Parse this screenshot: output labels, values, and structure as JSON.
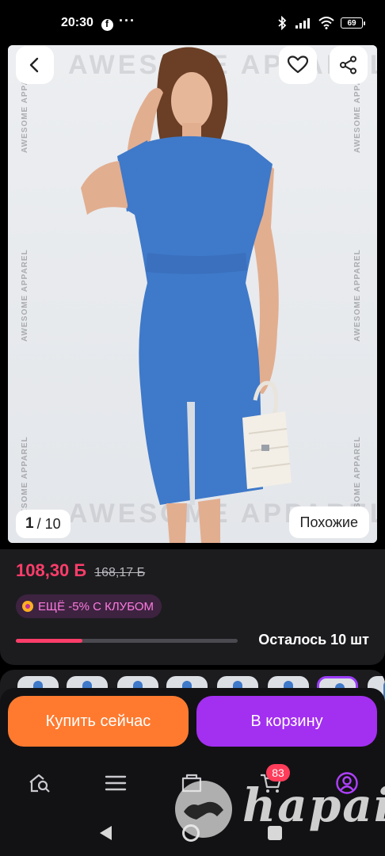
{
  "status_bar": {
    "time": "20:30",
    "extra": "···",
    "battery": "69"
  },
  "gallery": {
    "watermark_brand": "AWESOME APPAREL",
    "watermark_vertical": "AWESOME APPAREL",
    "current_image": "1",
    "total_images": "/ 10",
    "similar_label": "Похожие",
    "dress_color": "#3f79c9"
  },
  "price": {
    "current": "108,30 Ƃ",
    "old": "168,17 Ƃ",
    "club_badge": "ЕЩЁ -5% С КЛУБОМ",
    "stock_text": "Осталось 10 шт",
    "stock_fraction": 0.3,
    "accent": "#ff3d6a"
  },
  "actions": {
    "buy_now": "Купить сейчас",
    "add_to_cart": "В корзину",
    "buy_color": "#ff7a2f",
    "cart_color": "#a32ff0"
  },
  "bottom_nav": {
    "cart_badge": "83",
    "items": [
      "home-search-icon",
      "catalog-menu-icon",
      "orders-icon",
      "cart-icon",
      "profile-icon"
    ]
  },
  "watermark": {
    "text": "hapai"
  }
}
